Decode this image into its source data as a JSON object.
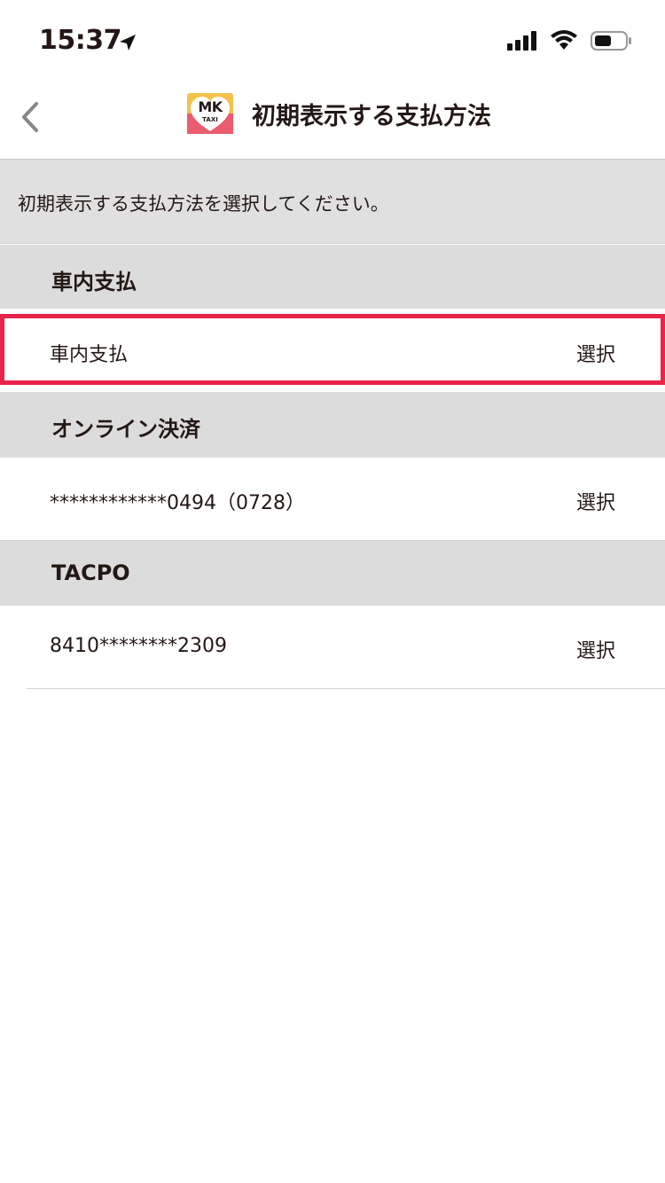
{
  "status_bar": {
    "time": "15:37"
  },
  "nav": {
    "title": "初期表示する支払方法",
    "logo_text": "MK",
    "logo_sub": "TAXI"
  },
  "description": "初期表示する支払方法を選択してください。",
  "sections": [
    {
      "header": "車内支払",
      "item": {
        "label": "車内支払",
        "action": "選択"
      }
    },
    {
      "header": "オンライン決済",
      "item": {
        "label": "************0494（0728）",
        "action": "選択"
      }
    },
    {
      "header": "TACPO",
      "item": {
        "label": "8410********2309",
        "action": "選択"
      }
    }
  ],
  "colors": {
    "highlight": "#e8244b",
    "section_bg": "#dcdcdc",
    "logo_yellow": "#f3c24a",
    "logo_pink": "#ea5c6e"
  }
}
